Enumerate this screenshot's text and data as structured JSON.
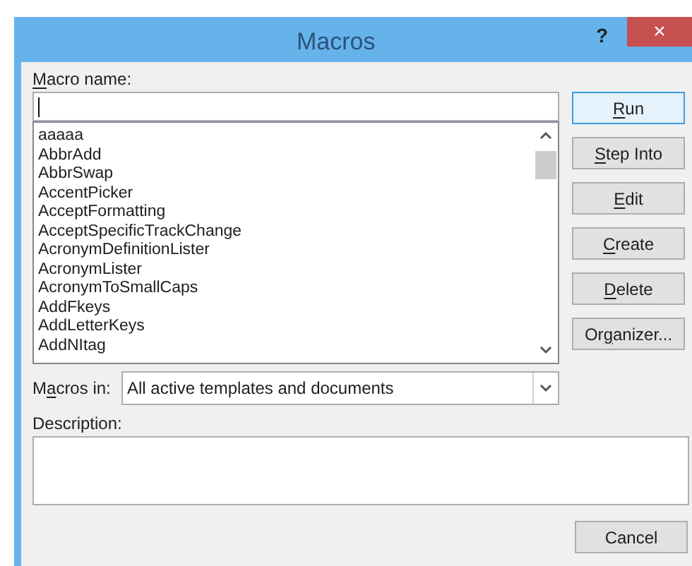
{
  "window": {
    "title": "Macros",
    "help": "?",
    "close": "×"
  },
  "macro_name": {
    "label": [
      {
        "text": "M",
        "underlined": true
      },
      {
        "text": "acro name:",
        "underlined": false
      }
    ]
  },
  "macro_list": [
    {
      "name": "aaaaa",
      "selected": false
    },
    {
      "name": "AbbrAdd",
      "selected": false
    },
    {
      "name": "AbbrSwap",
      "selected": false
    },
    {
      "name": "AccentPicker",
      "selected": false
    },
    {
      "name": "AcceptFormatting",
      "selected": false
    },
    {
      "name": "AcceptSpecificTrackChange",
      "selected": false
    },
    {
      "name": "AcronymDefinitionLister",
      "selected": false
    },
    {
      "name": "AcronymLister",
      "selected": false
    },
    {
      "name": "AcronymToSmallCaps",
      "selected": false
    },
    {
      "name": "AddFkeys",
      "selected": false
    },
    {
      "name": "AddLetterKeys",
      "selected": false
    },
    {
      "name": "AddNItag",
      "selected": false
    }
  ],
  "buttons": [
    {
      "label": [
        {
          "text": "R",
          "underlined": true
        },
        {
          "text": "un",
          "underlined": false
        }
      ],
      "default": true
    },
    {
      "label": [
        {
          "text": "S",
          "underlined": true
        },
        {
          "text": "tep Into",
          "underlined": false
        }
      ],
      "default": false
    },
    {
      "label": [
        {
          "text": "E",
          "underlined": true
        },
        {
          "text": "dit",
          "underlined": false
        }
      ],
      "default": false
    },
    {
      "label": [
        {
          "text": "C",
          "underlined": true
        },
        {
          "text": "reate",
          "underlined": false
        }
      ],
      "default": false
    },
    {
      "label": [
        {
          "text": "D",
          "underlined": true
        },
        {
          "text": "elete",
          "underlined": false
        }
      ],
      "default": false
    },
    {
      "label": [
        {
          "text": "Or",
          "underlined": false
        },
        {
          "text": "g",
          "underlined": true
        },
        {
          "text": "anizer...",
          "underlined": false
        }
      ],
      "default": false
    }
  ],
  "macros_in": {
    "label": [
      {
        "text": "M",
        "underlined": false
      },
      {
        "text": "a",
        "underlined": true
      },
      {
        "text": "cros in:",
        "underlined": false
      }
    ],
    "value": "All active templates and documents"
  },
  "description": {
    "label": "Description:"
  },
  "cancel_button": {
    "label": "Cancel"
  }
}
